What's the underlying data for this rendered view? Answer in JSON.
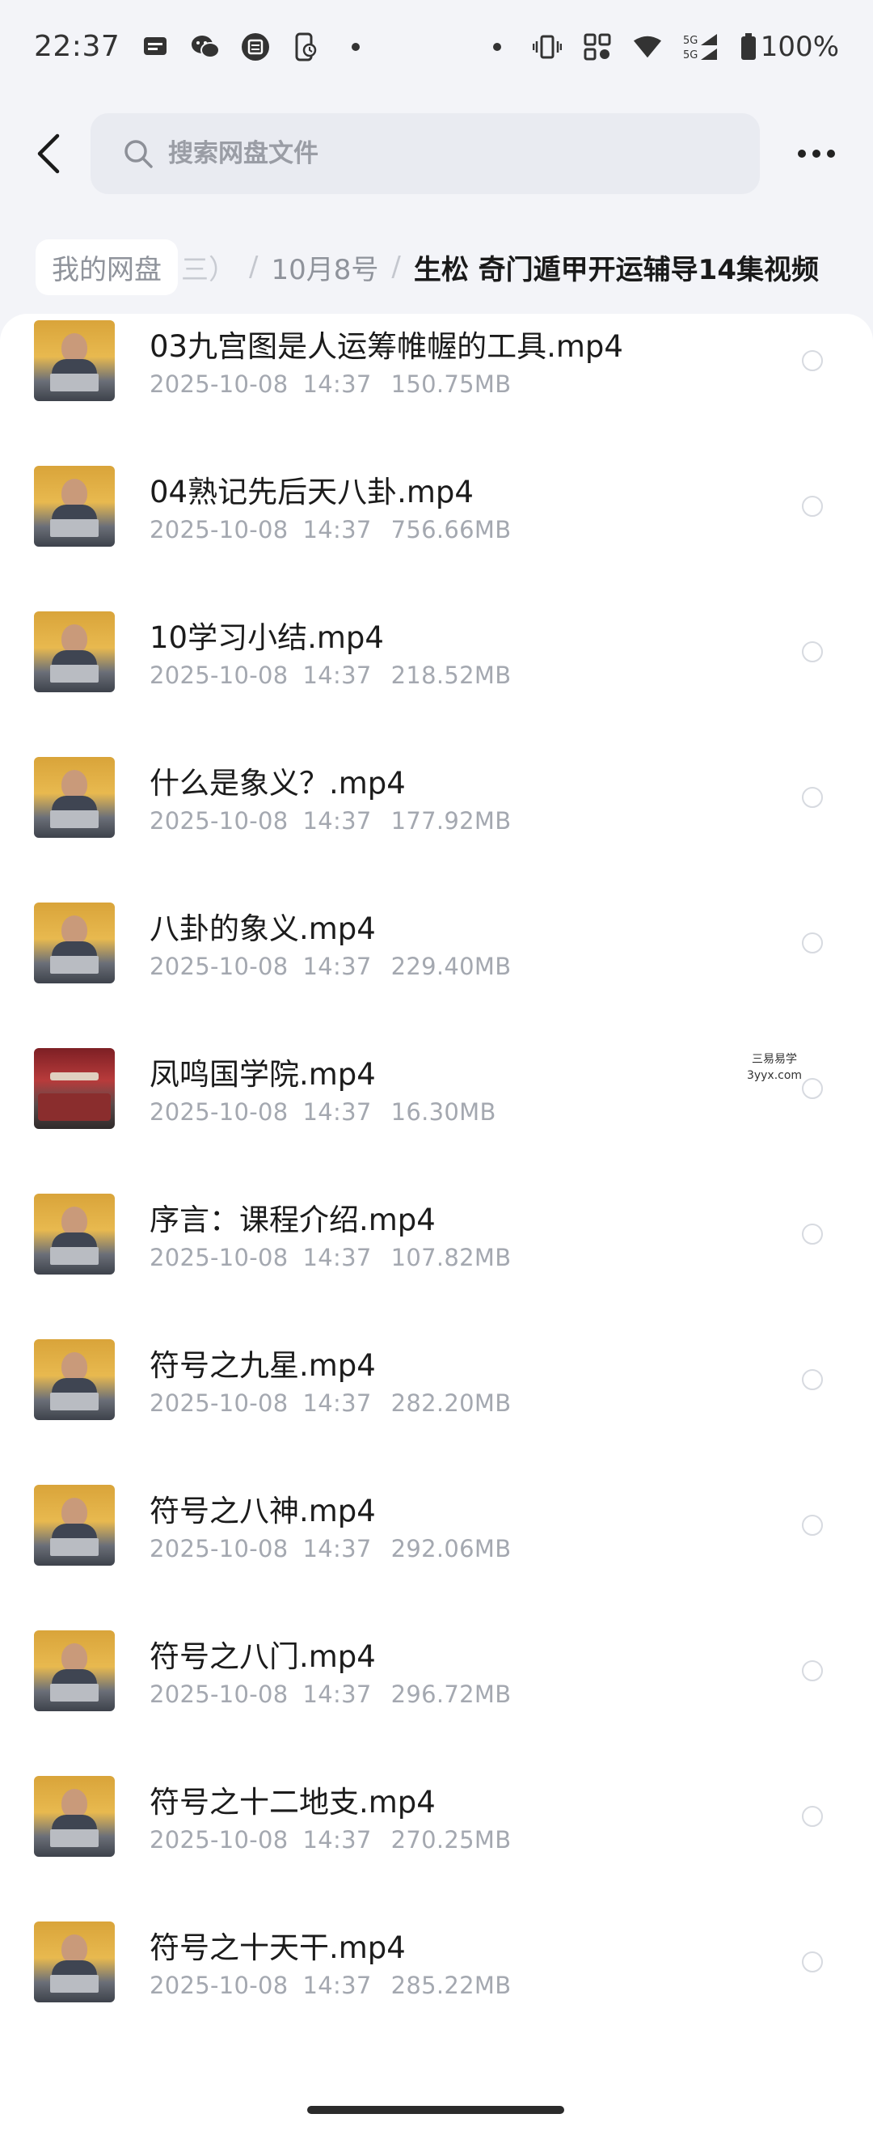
{
  "status_bar": {
    "time": "22:37",
    "battery": "100%",
    "network": "5G",
    "left_icons": [
      "message-icon",
      "wechat-icon",
      "calendar-icon",
      "phone-sync-icon",
      "dot-icon"
    ],
    "right_icons": [
      "dot-icon",
      "vibrate-icon",
      "nfc-icon",
      "wifi-icon",
      "signal-icon",
      "battery-icon"
    ]
  },
  "header": {
    "search_placeholder": "搜索网盘文件"
  },
  "breadcrumb": {
    "root": "我的网盘",
    "hidden_fragment": "三）",
    "middle": "10月8号",
    "current": "生松 奇门遁甲开运辅导14集视频",
    "separator": "/"
  },
  "files": [
    {
      "name": "03九宫图是人运筹帷幄的工具.mp4",
      "date": "2025-10-08",
      "time": "14:37",
      "size": "150.75MB"
    },
    {
      "name": "04熟记先后天八卦.mp4",
      "date": "2025-10-08",
      "time": "14:37",
      "size": "756.66MB"
    },
    {
      "name": "10学习小结.mp4",
      "date": "2025-10-08",
      "time": "14:37",
      "size": "218.52MB"
    },
    {
      "name": "什么是象义？.mp4",
      "date": "2025-10-08",
      "time": "14:37",
      "size": "177.92MB"
    },
    {
      "name": "八卦的象义.mp4",
      "date": "2025-10-08",
      "time": "14:37",
      "size": "229.40MB"
    },
    {
      "name": "凤鸣国学院.mp4",
      "date": "2025-10-08",
      "time": "14:37",
      "size": "16.30MB"
    },
    {
      "name": "序言：课程介绍.mp4",
      "date": "2025-10-08",
      "time": "14:37",
      "size": "107.82MB"
    },
    {
      "name": "符号之九星.mp4",
      "date": "2025-10-08",
      "time": "14:37",
      "size": "282.20MB"
    },
    {
      "name": "符号之八神.mp4",
      "date": "2025-10-08",
      "time": "14:37",
      "size": "292.06MB"
    },
    {
      "name": "符号之八门.mp4",
      "date": "2025-10-08",
      "time": "14:37",
      "size": "296.72MB"
    },
    {
      "name": "符号之十二地支.mp4",
      "date": "2025-10-08",
      "time": "14:37",
      "size": "270.25MB"
    },
    {
      "name": "符号之十天干.mp4",
      "date": "2025-10-08",
      "time": "14:37",
      "size": "285.22MB"
    }
  ],
  "watermark": {
    "line1": "三易易学",
    "line2": "3yyx.com"
  }
}
